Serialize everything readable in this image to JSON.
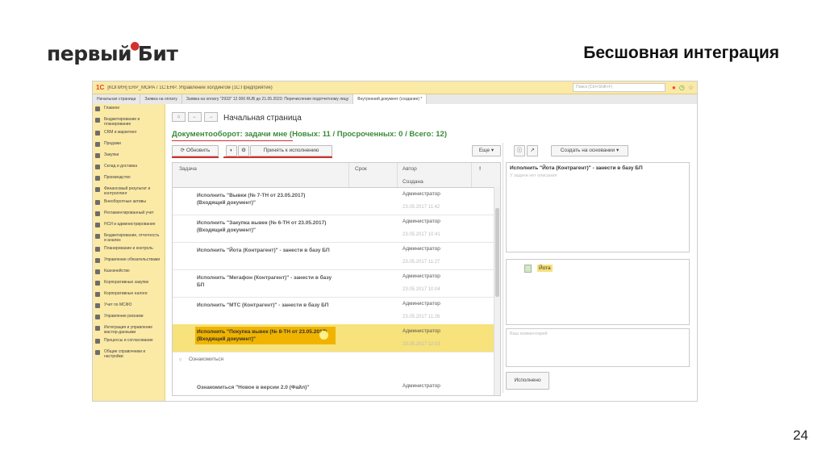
{
  "slide": {
    "logo_left": "первый",
    "logo_right": "Бит",
    "title": "Бесшовная интеграция",
    "page_number": "24"
  },
  "app": {
    "logo": "1С",
    "window_title": "[КОПИЯ] ERP_МОРА / 1С:ERP. Управление холдингом (1С:Предприятие)",
    "search_placeholder": "Поиск (Ctrl+Shift+F)",
    "tabs": [
      {
        "label": "Начальная страница",
        "active": false
      },
      {
        "label": "Заявка на оплату",
        "active": false
      },
      {
        "label": "Заявка на оплату \"2933\" 12 000 RUB до 21.05.2023: Перечисление подотчетному лицу",
        "active": false
      },
      {
        "label": "Внутренний документ (создание) *",
        "active": true
      }
    ]
  },
  "sidebar": {
    "items": [
      {
        "label": "Главное"
      },
      {
        "label": "Бюджетирование и планирование"
      },
      {
        "label": "CRM и маркетинг"
      },
      {
        "label": "Продажи"
      },
      {
        "label": "Закупки"
      },
      {
        "label": "Склад и доставка"
      },
      {
        "label": "Производство"
      },
      {
        "label": "Финансовый результат и контроллинг"
      },
      {
        "label": "Внеоборотные активы"
      },
      {
        "label": "Регламентированный учет"
      },
      {
        "label": "НСИ и администрирование"
      },
      {
        "label": "Бюджетирование, отчетность и анализ"
      },
      {
        "label": "Планирование и контроль"
      },
      {
        "label": "Управление обязательствами"
      },
      {
        "label": "Казначейство"
      },
      {
        "label": "Корпоративные закупки"
      },
      {
        "label": "Корпоративные налоги"
      },
      {
        "label": "Учет по МСФО"
      },
      {
        "label": "Управление рисками"
      },
      {
        "label": "Интеграция и управление мастер-данными"
      },
      {
        "label": "Процессы и согласование"
      },
      {
        "label": "Общие справочники и настройки"
      }
    ]
  },
  "main": {
    "page_title": "Начальная страница",
    "doc_header": "Документооборот: задачи мне (Новых: 11 / Просроченных: 0 / Всего: 12)",
    "buttons": {
      "refresh": "⟳ Обновить",
      "accept": "Принять к исполнению",
      "more": "Еще ▾",
      "create_based": "Создать на основании ▾"
    },
    "columns": {
      "task": "Задача",
      "due": "Срок",
      "author": "Автор",
      "created": "Создана",
      "flag": "!"
    },
    "tasks": [
      {
        "name": "Исполнить \"Вывки (№ 7-ТН от 23.05.2017) (Входящий документ)\"",
        "author": "Администратор",
        "date": "23.05.2017 11:42",
        "selected": false
      },
      {
        "name": "Исполнить \"Закупка вывек (№ 6-ТН от 23.05.2017) (Входящий документ)\"",
        "author": "Администратор",
        "date": "23.05.2017 10:41",
        "selected": false
      },
      {
        "name": "Исполнить \"Йота (Контрагент)\" - занести в базу БП",
        "author": "Администратор",
        "date": "23.05.2017 11:27",
        "selected": false
      },
      {
        "name": "Исполнить \"Мегафон (Контрагент)\" - занести в базу БП",
        "author": "Администратор",
        "date": "23.05.2017 10:04",
        "selected": false
      },
      {
        "name": "Исполнить \"МТС (Контрагент)\" - занести в базу БП",
        "author": "Администратор",
        "date": "23.05.2017 11:26",
        "selected": false
      },
      {
        "name": "Исполнить \"Покупка вывек (№ 8-ТН от 23.05.2017) (Входящий документ)\"",
        "author": "Администратор",
        "date": "23.05.2017 12:03",
        "selected": true
      }
    ],
    "group_label": "Ознакомиться",
    "last_task": {
      "name": "Ознакомиться \"Новое в версии 2.0 (Файл)\"",
      "author": "Администратор"
    }
  },
  "detail": {
    "title": "Исполнить \"Йота (Контрагент)\" - занести в базу БП",
    "description_placeholder": "У задачи нет описания",
    "attachment": "Йота",
    "comment_placeholder": "Ваш комментарий",
    "done_button": "Исполнено"
  },
  "colors": {
    "sidebar_bg": "#fbe9a6",
    "header_green": "#3a8a3a",
    "highlight": "#f0b400",
    "accent_red": "#d32f2f"
  }
}
